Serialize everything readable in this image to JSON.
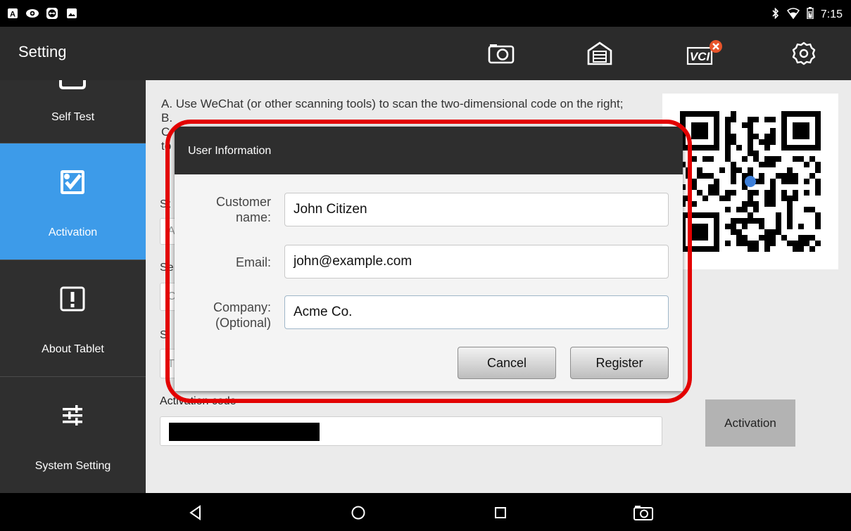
{
  "status_bar": {
    "left_icons": [
      "a-icon",
      "eye-icon",
      "teamviewer-icon",
      "image-icon"
    ],
    "time": "7:15"
  },
  "toolbar": {
    "title": "Setting",
    "vci_label": "VCI",
    "error_color": "#e8542a"
  },
  "sidebar": {
    "items": [
      {
        "label": "Self Test",
        "icon": "self-test-icon"
      },
      {
        "label": "Activation",
        "icon": "activation-icon",
        "active": true
      },
      {
        "label": "About Tablet",
        "icon": "exclamation-icon"
      },
      {
        "label": "System Setting",
        "icon": "sliders-icon"
      }
    ],
    "active_color": "#3d9be9"
  },
  "main": {
    "instruction_a": "A. Use WeChat (or other scanning tools) to scan the two-dimensional code on the right;",
    "instruction_b": "B.",
    "instruction_c": "C",
    "instruction_d": "to",
    "partial_label_1": "St",
    "partial_value_1": "A",
    "partial_label_2": "Se",
    "partial_value_2": "C",
    "partial_label_3": "Si",
    "partial_value_3": "T",
    "activation_code_label": "Activation code",
    "activation_button": "Activation"
  },
  "dialog": {
    "title": "User Information",
    "customer_name_label_line1": "Customer",
    "customer_name_label_line2": "name:",
    "customer_name_value": "John Citizen",
    "email_label": "Email:",
    "email_value": "john@example.com",
    "company_label_line1": "Company:",
    "company_label_line2": "(Optional)",
    "company_value": "Acme Co.",
    "cancel_button": "Cancel",
    "register_button": "Register"
  },
  "highlight_color": "#e30000"
}
